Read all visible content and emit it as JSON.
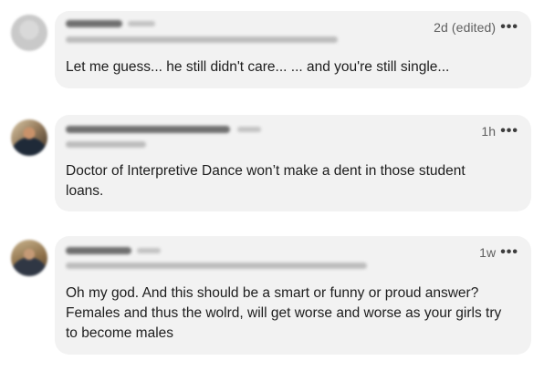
{
  "comments": [
    {
      "time": "2d (edited)",
      "text": "Let me guess... he still didn't care... ... and you're still single...",
      "more_icon": "more-horizontal-icon"
    },
    {
      "time": "1h",
      "text": "Doctor of Interpretive Dance won’t make a dent in those student loans.",
      "more_icon": "more-horizontal-icon"
    },
    {
      "time": "1w",
      "text": "Oh my god. And this should be a smart or funny or proud answer? Females and thus the wolrd,  will get worse and worse as your girls try to become males",
      "more_icon": "more-horizontal-icon"
    }
  ],
  "more_glyph": "•••"
}
